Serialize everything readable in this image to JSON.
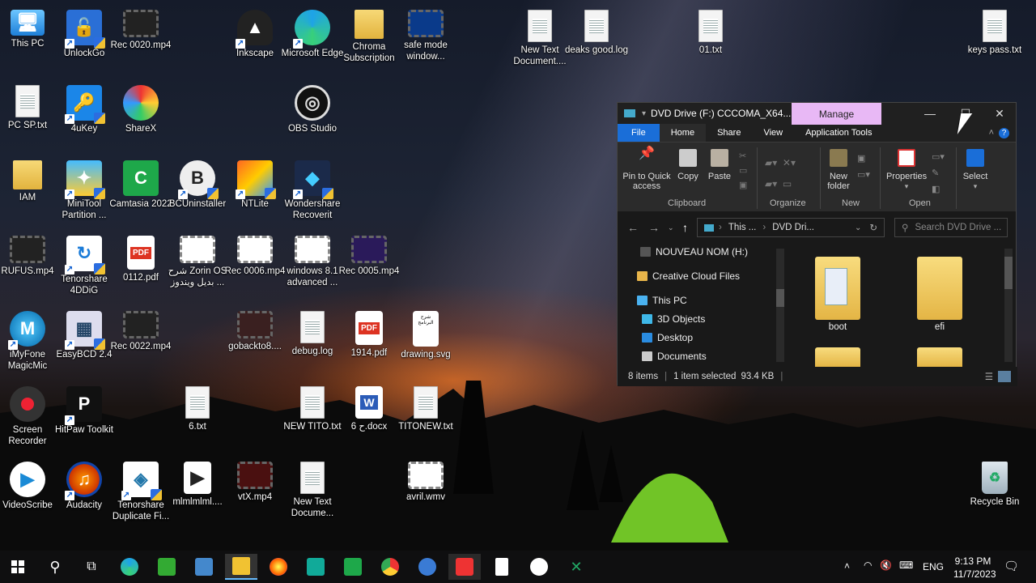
{
  "desktop": {
    "icons": [
      {
        "label": "This PC"
      },
      {
        "label": "UnlockGo"
      },
      {
        "label": "Rec 0020.mp4"
      },
      {
        "label": "Inkscape"
      },
      {
        "label": "Microsoft Edge"
      },
      {
        "label": "Chroma Subscription"
      },
      {
        "label": "safe mode window..."
      },
      {
        "label": "New Text Document...."
      },
      {
        "label": "deaks good.log"
      },
      {
        "label": "01.txt"
      },
      {
        "label": "keys pass.txt"
      },
      {
        "label": "PC SP.txt"
      },
      {
        "label": "4uKey"
      },
      {
        "label": "ShareX"
      },
      {
        "label": "OBS Studio"
      },
      {
        "label": "IAM"
      },
      {
        "label": "MiniTool Partition ..."
      },
      {
        "label": "Camtasia 2022"
      },
      {
        "label": "BCUninstaller"
      },
      {
        "label": "NTLite"
      },
      {
        "label": "Wondershare Recoverit"
      },
      {
        "label": "RUFUS.mp4"
      },
      {
        "label": "Tenorshare 4DDiG"
      },
      {
        "label": "0112.pdf"
      },
      {
        "label": "شرح Zorin OS بديل ويندوز ..."
      },
      {
        "label": "Rec 0006.mp4"
      },
      {
        "label": "windows 8.1 advanced ..."
      },
      {
        "label": "Rec 0005.mp4"
      },
      {
        "label": "iMyFone MagicMic"
      },
      {
        "label": "EasyBCD 2.4"
      },
      {
        "label": "Rec 0022.mp4"
      },
      {
        "label": "gobackto8...."
      },
      {
        "label": "debug.log"
      },
      {
        "label": "1914.pdf"
      },
      {
        "label": "drawing.svg"
      },
      {
        "label": "Screen Recorder"
      },
      {
        "label": "HitPaw Toolkit"
      },
      {
        "label": "6.txt"
      },
      {
        "label": "NEW TITO.txt"
      },
      {
        "label": "6 ح.docx"
      },
      {
        "label": "TITONEW.txt"
      },
      {
        "label": "VideoScribe"
      },
      {
        "label": "Audacity"
      },
      {
        "label": "Tenorshare Duplicate Fi..."
      },
      {
        "label": "mlmlmlml...."
      },
      {
        "label": "vtX.mp4"
      },
      {
        "label": "New Text Docume..."
      },
      {
        "label": "avril.wmv"
      },
      {
        "label": "Recycle Bin"
      }
    ],
    "pdf_badge": "PDF",
    "word_badge": "W",
    "svg_thumb_text": "شرح البرنامج"
  },
  "explorer": {
    "title": "DVD Drive (F:) CCCOMA_X64...",
    "manage_tab": "Manage",
    "menu": {
      "file": "File",
      "home": "Home",
      "share": "Share",
      "view": "View",
      "app_tools": "Application Tools"
    },
    "ribbon": {
      "pin": "Pin to Quick access",
      "copy": "Copy",
      "paste": "Paste",
      "new_folder": "New folder",
      "properties": "Properties",
      "select": "Select",
      "groups": {
        "clipboard": "Clipboard",
        "organize": "Organize",
        "new": "New",
        "open": "Open"
      }
    },
    "address": {
      "crumb1": "This ...",
      "crumb2": "DVD Dri...",
      "search_placeholder": "Search DVD Drive ..."
    },
    "nav": [
      {
        "label": "NOUVEAU NOM (H:)"
      },
      {
        "label": "Creative Cloud Files"
      },
      {
        "label": "This PC"
      },
      {
        "label": "3D Objects"
      },
      {
        "label": "Desktop"
      },
      {
        "label": "Documents"
      }
    ],
    "files": [
      {
        "name": "boot"
      },
      {
        "name": "efi"
      }
    ],
    "status": {
      "items": "8 items",
      "selected": "1 item selected",
      "size": "93.4 KB"
    }
  },
  "taskbar": {
    "language": "ENG",
    "time": "9:13 PM",
    "date": "11/7/2023",
    "apps": [
      "start-icon",
      "search-icon",
      "task-view-icon",
      "edge-icon",
      "app-icon",
      "app-icon",
      "file-explorer-icon",
      "firefox-icon",
      "app-icon",
      "camtasia-icon",
      "chrome-icon",
      "qbittorrent-icon",
      "app-icon",
      "notepad-icon",
      "videoscribe-icon",
      "app-icon"
    ]
  },
  "colors": {
    "accent": "#1a6ed8",
    "manage_tab": "#e8b8f5",
    "taskbar": "#0f0f10"
  }
}
